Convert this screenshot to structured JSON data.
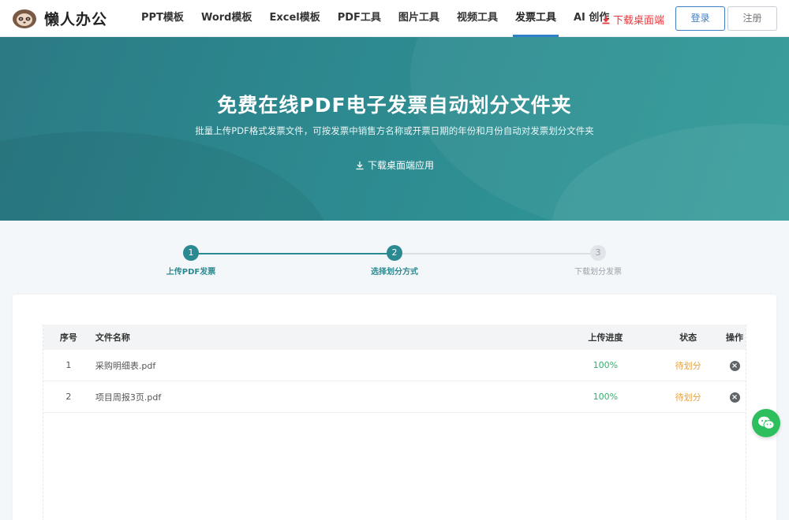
{
  "header": {
    "logo_text": "懒人办公",
    "nav": [
      {
        "label": "PPT模板"
      },
      {
        "label": "Word模板"
      },
      {
        "label": "Excel模板"
      },
      {
        "label": "PDF工具"
      },
      {
        "label": "图片工具"
      },
      {
        "label": "视频工具"
      },
      {
        "label": "发票工具",
        "active": true
      },
      {
        "label": "AI 创作"
      }
    ],
    "download_label": "下载桌面端",
    "login_label": "登录",
    "register_label": "注册",
    "accent_color": "#2f80c8",
    "download_color": "#e8383d"
  },
  "hero": {
    "title": "免费在线PDF电子发票自动划分文件夹",
    "subtitle": "批量上传PDF格式发票文件，可按发票中销售方名称或开票日期的年份和月份自动对发票划分文件夹",
    "app_download_label": "下载桌面端应用",
    "background_color": "#2d8a90"
  },
  "steps": [
    {
      "number": "1",
      "label": "上传PDF发票",
      "state": "done"
    },
    {
      "number": "2",
      "label": "选择划分方式",
      "state": "done"
    },
    {
      "number": "3",
      "label": "下载划分发票",
      "state": "todo"
    }
  ],
  "table": {
    "headers": {
      "index": "序号",
      "name": "文件名称",
      "progress": "上传进度",
      "status": "状态",
      "action": "操作"
    },
    "rows": [
      {
        "index": "1",
        "name": "采购明细表.pdf",
        "progress": "100%",
        "status": "待划分"
      },
      {
        "index": "2",
        "name": "项目周报3页.pdf",
        "progress": "100%",
        "status": "待划分"
      }
    ],
    "progress_color": "#2fb36b",
    "status_color": "#e8a23a"
  },
  "floating": {
    "icon": "wechat-icon",
    "color": "#2dbf5e"
  }
}
